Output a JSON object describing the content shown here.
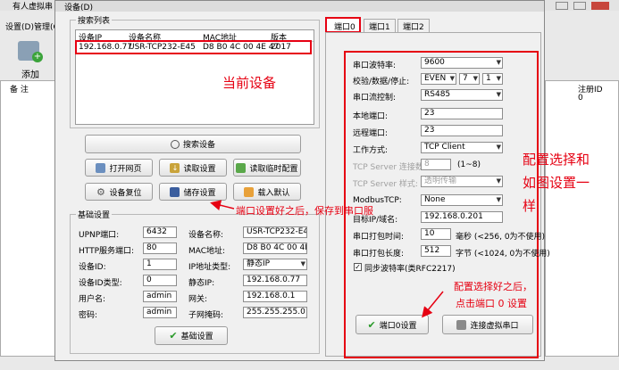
{
  "bg_window": {
    "title": "有人虚拟串",
    "menu": [
      "设置(D)",
      "管理(G)"
    ],
    "toolbar_add": "添加",
    "col_note": "备 注",
    "col_reg_id": "注册ID",
    "reg_value": "0"
  },
  "dialog": {
    "title": "设备(D)",
    "search_list": {
      "title": "搜索列表",
      "headers": [
        "设备IP",
        "设备名称",
        "MAC地址",
        "版本"
      ],
      "rows": [
        [
          "192.168.0.77",
          "USR-TCP232-E45",
          "D8 B0 4C 00 4E 47",
          "2017"
        ]
      ]
    },
    "buttons": {
      "search": "搜索设备",
      "open_web": "打开网页",
      "read_settings": "读取设置",
      "read_temp": "读取临时配置",
      "reset": "设备复位",
      "save": "储存设置",
      "load_default": "载入默认",
      "basic_settings": "基础设置",
      "port0_settings": "端口0设置",
      "connect_virtual": "连接虚拟串口"
    },
    "basic": {
      "title": "基础设置",
      "upnp_label": "UPNP端口:",
      "upnp": "6432",
      "http_label": "HTTP服务端口:",
      "http": "80",
      "devid_label": "设备ID:",
      "devid": "1",
      "devidtype_label": "设备ID类型:",
      "devidtype": "0",
      "user_label": "用户名:",
      "user": "admin",
      "pass_label": "密码:",
      "pass": "admin",
      "name_label": "设备名称:",
      "name": "USR-TCP232-E45",
      "mac_label": "MAC地址:",
      "mac": "D8 B0 4C 00 4E 47",
      "iptype_label": "IP地址类型:",
      "iptype": "静态IP",
      "staticip_label": "静态IP:",
      "staticip": "192.168.0.77",
      "gateway_label": "网关:",
      "gateway": "192.168.0.1",
      "mask_label": "子网掩码:",
      "mask": "255.255.255.0"
    },
    "tabs": [
      "端口0",
      "端口1",
      "端口2"
    ],
    "port": {
      "baud_label": "串口波特率:",
      "baud": "9600",
      "check_label": "校验/数据/停止:",
      "parity": "EVEN",
      "databits": "7",
      "stopbits": "1",
      "flow_label": "串口流控制:",
      "flow": "RS485",
      "local_label": "本地端口:",
      "local": "23",
      "remote_label": "远程端口:",
      "remote": "23",
      "mode_label": "工作方式:",
      "mode": "TCP Client",
      "conn_label": "TCP Server 连接数:",
      "conn": "8",
      "conn_hint": "(1~8)",
      "style_label": "TCP Server 样式:",
      "style": "透明传输",
      "modbus_label": "ModbusTCP:",
      "modbus": "None",
      "target_label": "目标IP/域名:",
      "target": "192.168.0.201",
      "pack_time_label": "串口打包时间:",
      "pack_time": "10",
      "pack_time_hint": "毫秒 (<256, 0为不使用)",
      "pack_len_label": "串口打包长度:",
      "pack_len": "512",
      "pack_len_hint": "字节 (<1024, 0为不使用)",
      "sync_label": "同步波特率(类RFC2217)"
    }
  },
  "annotations": {
    "current_device": "当前设备",
    "save_hint": "端口设置好之后，保存到串口服",
    "config_line1": "配置选择和",
    "config_line2": "如图设置一",
    "config_line3": "样",
    "click_line1": "配置选择好之后，",
    "click_line2": "点击端口 0 设置"
  },
  "colors": {
    "annotation": "#e60012",
    "selection": "#3399ff"
  }
}
